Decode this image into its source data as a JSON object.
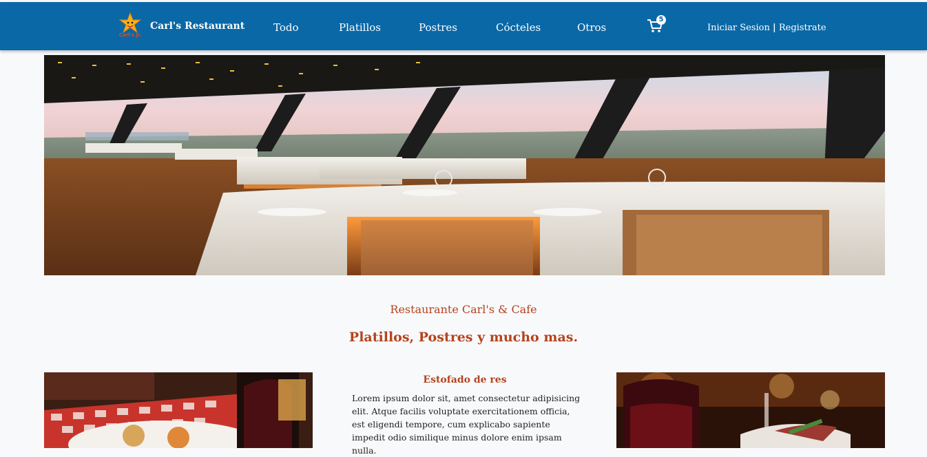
{
  "header": {
    "brand": "Carl's Restaurant",
    "logo_caption": "Carl's Jr.",
    "nav": [
      "Todo",
      "Platillos",
      "Postres",
      "Cócteles",
      "Otros"
    ],
    "cart_count": "5",
    "login": "Iniciar Sesion",
    "separator": "|",
    "register": "Registrate",
    "bg_color": "#0a68a6"
  },
  "hero": {
    "image": "restaurant-dining-room-panorama"
  },
  "intro": {
    "subtitle": "Restaurante Carl's & Cafe",
    "headline": "Platillos, Postres y mucho mas.",
    "accent_color": "#b5431d"
  },
  "featured": {
    "title": "Estofado de res",
    "description": "Lorem ipsum dolor sit, amet consectetur adipisicing elit. Atque facilis voluptate exercitationem officia, est eligendi tempore, cum explicabo sapiente impedit odio similique minus dolore enim ipsam nulla.",
    "left_image": "plated-food-with-red-wine",
    "right_image": "wine-glasses-and-dish"
  }
}
